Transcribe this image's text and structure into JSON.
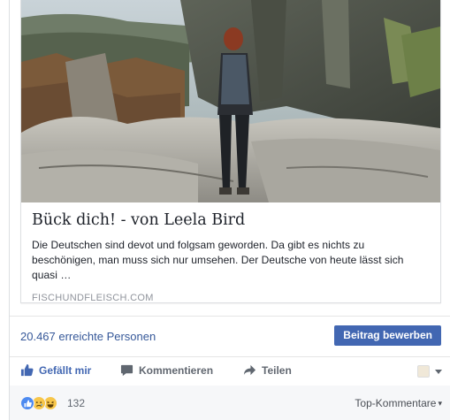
{
  "link_preview": {
    "title": "Bück dich! - von Leela Bird",
    "description": "Die Deutschen sind devot und folgsam geworden. Da gibt es nichts zu beschönigen, man muss sich nur umsehen. Der Deutsche von heute lässt sich quasi …",
    "domain": "FISCHUNDFLEISCH.COM"
  },
  "reach": {
    "text": "20.467 erreichte Personen",
    "boost_label": "Beitrag bewerben"
  },
  "actions": {
    "like_label": "Gefällt mir",
    "comment_label": "Kommentieren",
    "share_label": "Teilen"
  },
  "reactions": {
    "count": "132",
    "sort_label": "Top-Kommentare",
    "types": [
      "like",
      "sad",
      "haha"
    ]
  },
  "colors": {
    "link_blue": "#365899",
    "button_blue": "#4267b2",
    "secondary_text": "#90949c"
  }
}
